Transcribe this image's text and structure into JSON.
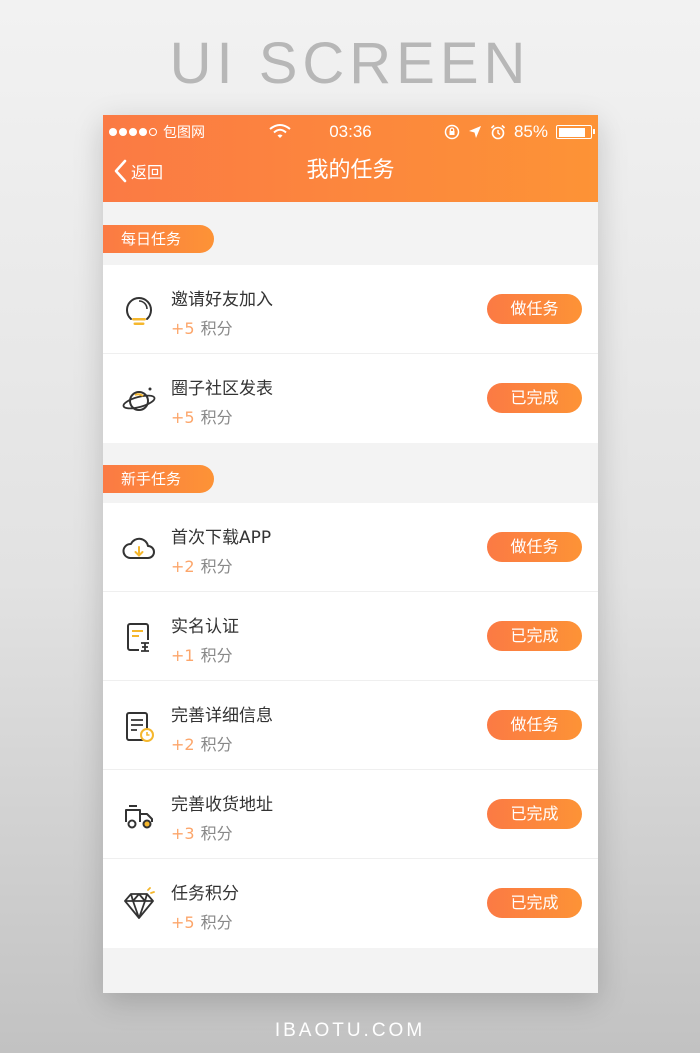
{
  "header": {
    "title": "UI SCREEN"
  },
  "footer": {
    "brand": "IBAOTU.COM"
  },
  "status": {
    "carrier": "包图网",
    "time": "03:36",
    "battery": "85%"
  },
  "nav": {
    "back_label": "返回",
    "title": "我的任务"
  },
  "sections": [
    {
      "title": "每日任务",
      "items": [
        {
          "icon": "lightbulb-icon",
          "title": "邀请好友加入",
          "points_value": "+5",
          "points_label": "积分",
          "button": "做任务"
        },
        {
          "icon": "planet-icon",
          "title": "圈子社区发表",
          "points_value": "+5",
          "points_label": "积分",
          "button": "已完成"
        }
      ]
    },
    {
      "title": "新手任务",
      "items": [
        {
          "icon": "cloud-download-icon",
          "title": "首次下载APP",
          "points_value": "+2",
          "points_label": "积分",
          "button": "做任务"
        },
        {
          "icon": "id-document-icon",
          "title": "实名认证",
          "points_value": "+1",
          "points_label": "积分",
          "button": "已完成"
        },
        {
          "icon": "document-clock-icon",
          "title": "完善详细信息",
          "points_value": "+2",
          "points_label": "积分",
          "button": "做任务"
        },
        {
          "icon": "delivery-truck-icon",
          "title": "完善收货地址",
          "points_value": "+3",
          "points_label": "积分",
          "button": "已完成"
        },
        {
          "icon": "diamond-icon",
          "title": "任务积分",
          "points_value": "+5",
          "points_label": "积分",
          "button": "已完成"
        }
      ]
    }
  ],
  "colors": {
    "accent_start": "#fb7a44",
    "accent_end": "#fd9336",
    "points": "#fca66b"
  }
}
